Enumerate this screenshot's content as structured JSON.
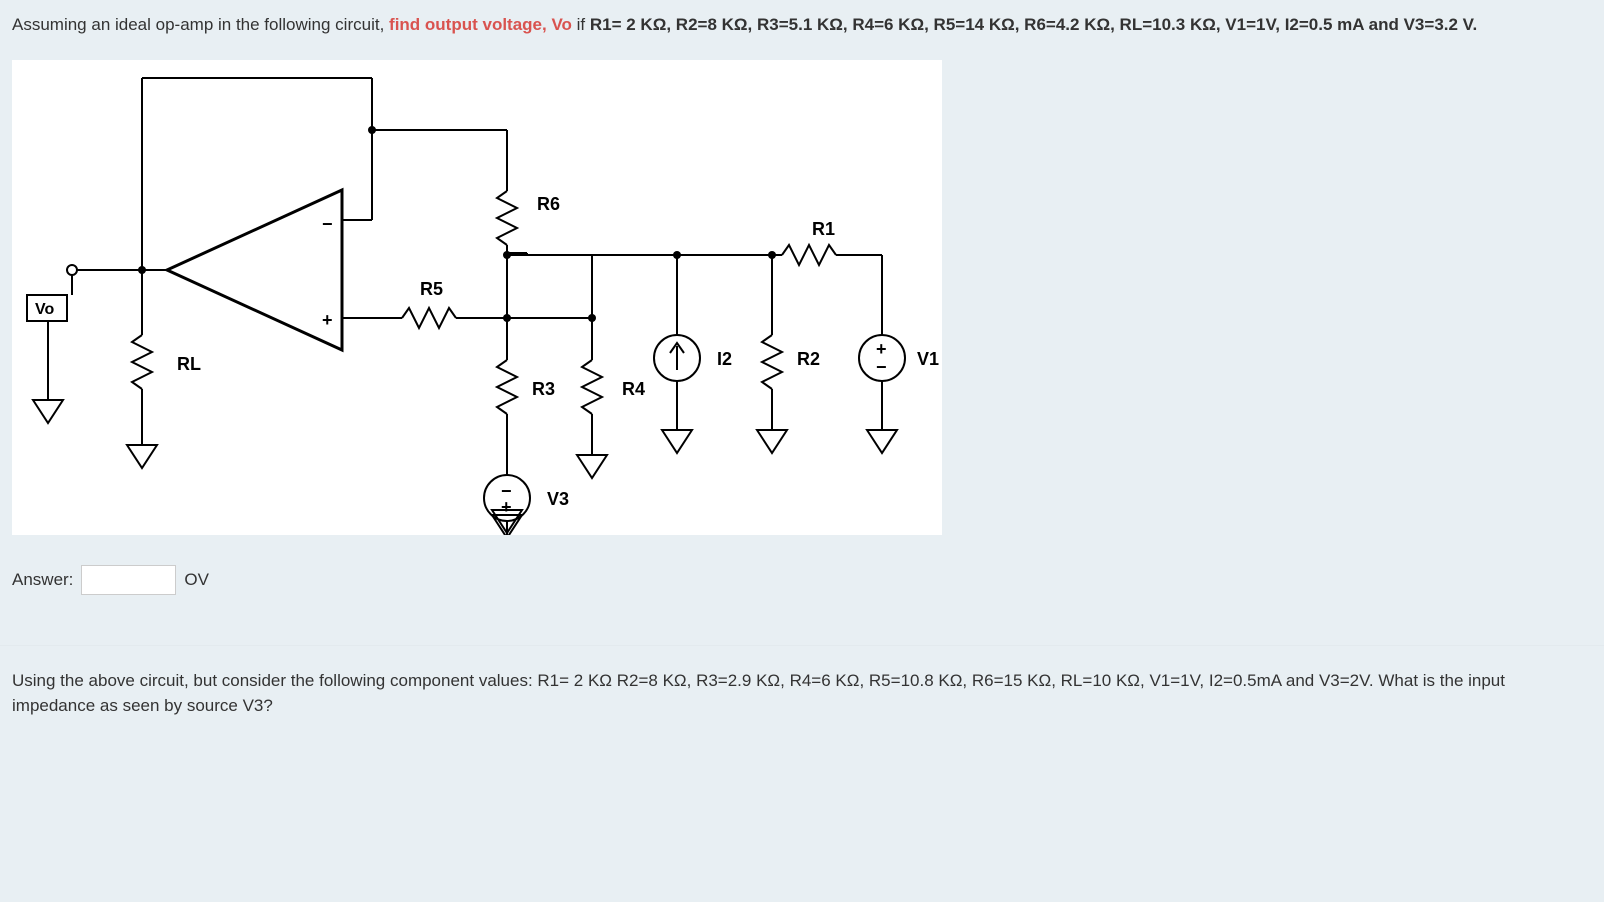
{
  "q1": {
    "prefix": "Assuming an ideal op-amp in the following circuit, ",
    "findVo": "find output voltage, Vo",
    "if": " if ",
    "params": "R1= 2 KΩ, R2=8 KΩ, R3=5.1 KΩ, R4=6 KΩ, R5=14 KΩ, R6=4.2 KΩ, RL=10.3 KΩ, V1=1V, I2=0.5 mA and V3=3.2 V."
  },
  "circuit": {
    "Vo": "Vo",
    "RL": "RL",
    "R1": "R1",
    "R2": "R2",
    "R3": "R3",
    "R4": "R4",
    "R5": "R5",
    "R6": "R6",
    "V1": "V1",
    "V3": "V3",
    "I2": "I2",
    "plus": "+",
    "minus": "−"
  },
  "answer": {
    "label": "Answer:",
    "unit": "OV"
  },
  "q2": {
    "prefix": "Using the above circuit, but consider the following component values:  ",
    "params": "R1= 2 KΩ R2=8 KΩ, R3=2.9 KΩ, R4=6 KΩ, R5=10.8 KΩ, R6=15 KΩ, RL=10 KΩ, V1=1V, I2=0.5mA and V3=2V.",
    "question": " What is the input impedance as seen by source V3?"
  }
}
